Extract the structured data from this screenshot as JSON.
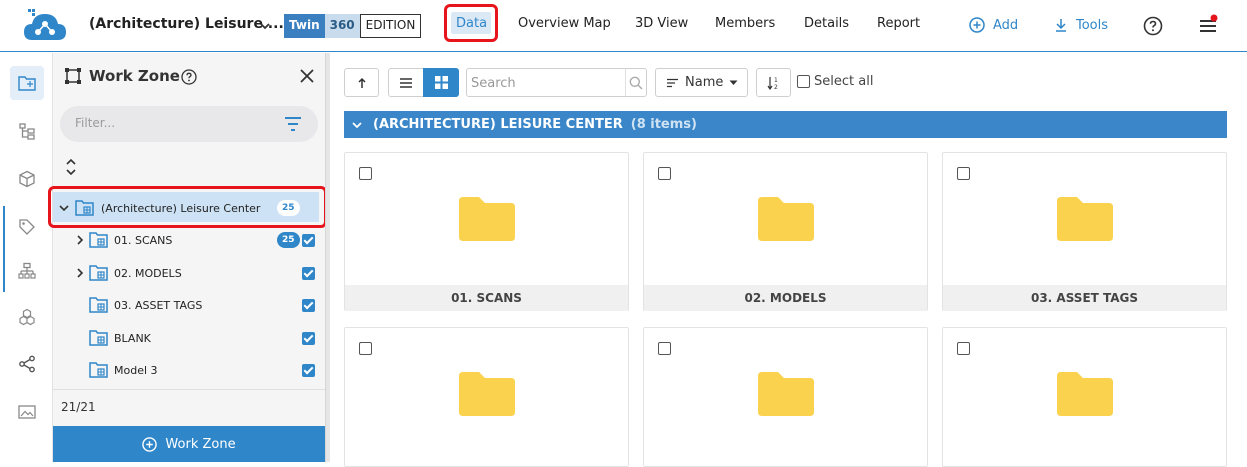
{
  "header": {
    "project_title": "(Architecture) Leisure ...",
    "edition": {
      "twin": "Twin",
      "num": "360",
      "label": "EDITION"
    },
    "tabs": [
      {
        "label": "Data",
        "active": true
      },
      {
        "label": "Overview Map"
      },
      {
        "label": "3D View"
      },
      {
        "label": "Members"
      },
      {
        "label": "Details"
      },
      {
        "label": "Report"
      }
    ],
    "add_label": "Add",
    "tools_label": "Tools"
  },
  "panel": {
    "title": "Work Zone",
    "filter_placeholder": "Filter...",
    "root": {
      "label": "(Architecture) Leisure Center",
      "count": "25"
    },
    "items": [
      {
        "label": "01. SCANS",
        "count": "25"
      },
      {
        "label": "02. MODELS"
      },
      {
        "label": "03. ASSET TAGS"
      },
      {
        "label": "BLANK"
      },
      {
        "label": "Model 3"
      }
    ],
    "footer_count": "21/21",
    "button_label": "Work Zone"
  },
  "toolbar": {
    "search_placeholder": "Search",
    "sort_label": "Name",
    "select_all_label": "Select all"
  },
  "group": {
    "title": "(ARCHITECTURE) LEISURE CENTER",
    "count": "(8 items)"
  },
  "cards": [
    {
      "label": "01. SCANS"
    },
    {
      "label": "02. MODELS"
    },
    {
      "label": "03. ASSET TAGS"
    },
    {
      "label": ""
    },
    {
      "label": ""
    },
    {
      "label": ""
    }
  ],
  "colors": {
    "accent": "#2f86c9",
    "highlight": "#e8141b",
    "folder": "#fbd24e"
  }
}
